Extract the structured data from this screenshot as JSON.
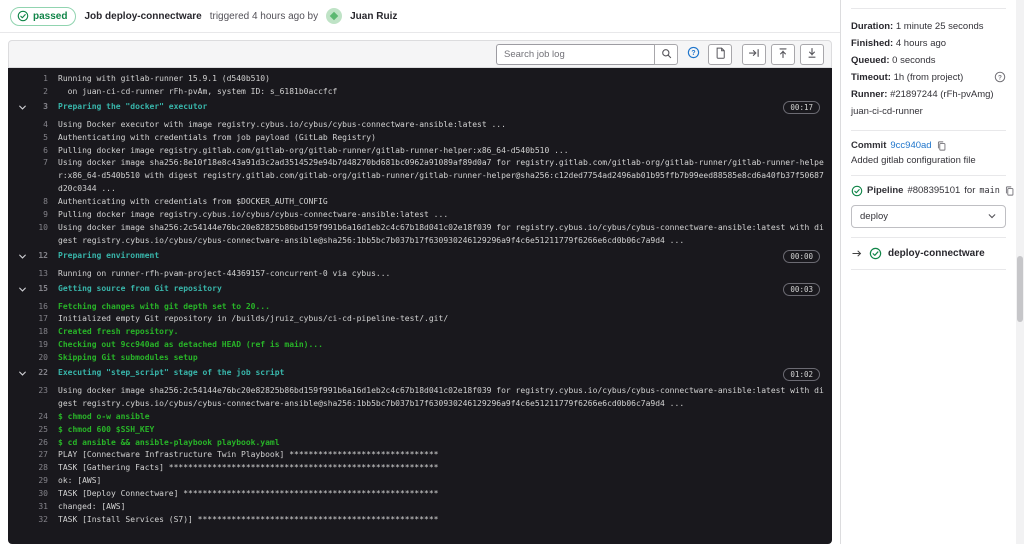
{
  "header": {
    "status_badge": "passed",
    "job_label": "Job deploy-connectware",
    "triggered_text": "triggered 4 hours ago by",
    "user": "Juan Ruiz"
  },
  "toolbar": {
    "search_placeholder": "Search job log"
  },
  "log": {
    "lines": [
      {
        "num": 1,
        "type": "plain",
        "text": "Running with gitlab-runner 15.9.1 (d540b510)"
      },
      {
        "num": 2,
        "type": "plain",
        "text": "  on juan-ci-cd-runner rFh-pvAm, system ID: s_6181b0accfcf"
      },
      {
        "num": 3,
        "type": "section",
        "duration": "00:17",
        "text": "Preparing the \"docker\" executor"
      },
      {
        "num": 4,
        "type": "plain",
        "text": "Using Docker executor with image registry.cybus.io/cybus/cybus-connectware-ansible:latest ..."
      },
      {
        "num": 5,
        "type": "plain",
        "text": "Authenticating with credentials from job payload (GitLab Registry)"
      },
      {
        "num": 6,
        "type": "plain",
        "text": "Pulling docker image registry.gitlab.com/gitlab-org/gitlab-runner/gitlab-runner-helper:x86_64-d540b510 ..."
      },
      {
        "num": 7,
        "type": "plain",
        "text": "Using docker image sha256:8e10f18e8c43a91d3c2ad3514529e94b7d48270bd681bc0962a91089af89d0a7 for registry.gitlab.com/gitlab-org/gitlab-runner/gitlab-runner-helper:x86_64-d540b510 with digest registry.gitlab.com/gitlab-org/gitlab-runner/gitlab-runner-helper@sha256:c12ded7754ad2496ab01b95ffb7b99eed88585e8cd6a40fb37f50687d20c0344 ..."
      },
      {
        "num": 8,
        "type": "plain",
        "text": "Authenticating with credentials from $DOCKER_AUTH_CONFIG"
      },
      {
        "num": 9,
        "type": "plain",
        "text": "Pulling docker image registry.cybus.io/cybus/cybus-connectware-ansible:latest ..."
      },
      {
        "num": 10,
        "type": "plain",
        "text": "Using docker image sha256:2c54144e76bc20e82825b86bd159f991b6a16d1eb2c4c67b18d041c02e18f039 for registry.cybus.io/cybus/cybus-connectware-ansible:latest with digest registry.cybus.io/cybus/cybus-connectware-ansible@sha256:1bb5bc7b037b17f630930246129296a9f4c6e51211779f6266e6cd0b06c7a9d4 ..."
      },
      {
        "num": 12,
        "type": "section",
        "duration": "00:00",
        "text": "Preparing environment"
      },
      {
        "num": 13,
        "type": "plain",
        "text": "Running on runner-rfh-pvam-project-44369157-concurrent-0 via cybus..."
      },
      {
        "num": 15,
        "type": "section",
        "duration": "00:03",
        "text": "Getting source from Git repository"
      },
      {
        "num": 16,
        "type": "green",
        "text": "Fetching changes with git depth set to 20..."
      },
      {
        "num": 17,
        "type": "plain",
        "text": "Initialized empty Git repository in /builds/jruiz_cybus/ci-cd-pipeline-test/.git/"
      },
      {
        "num": 18,
        "type": "green",
        "text": "Created fresh repository."
      },
      {
        "num": 19,
        "type": "green",
        "text": "Checking out 9cc940ad as detached HEAD (ref is main)..."
      },
      {
        "num": 20,
        "type": "green",
        "text": "Skipping Git submodules setup"
      },
      {
        "num": 22,
        "type": "section",
        "duration": "01:02",
        "text": "Executing \"step_script\" stage of the job script"
      },
      {
        "num": 23,
        "type": "plain",
        "text": "Using docker image sha256:2c54144e76bc20e82825b86bd159f991b6a16d1eb2c4c67b18d041c02e18f039 for registry.cybus.io/cybus/cybus-connectware-ansible:latest with digest registry.cybus.io/cybus/cybus-connectware-ansible@sha256:1bb5bc7b037b17f630930246129296a9f4c6e51211779f6266e6cd0b06c7a9d4 ..."
      },
      {
        "num": 24,
        "type": "green",
        "text": "$ chmod o-w ansible"
      },
      {
        "num": 25,
        "type": "green",
        "text": "$ chmod 600 $SSH_KEY"
      },
      {
        "num": 26,
        "type": "green",
        "text": "$ cd ansible && ansible-playbook playbook.yaml"
      },
      {
        "num": 27,
        "type": "plain",
        "text": "PLAY [Connectware Infrastructure Twin Playbook] *******************************"
      },
      {
        "num": 28,
        "type": "plain",
        "text": "TASK [Gathering Facts] ********************************************************"
      },
      {
        "num": 29,
        "type": "plain",
        "text": "ok: [AWS]"
      },
      {
        "num": 30,
        "type": "plain",
        "text": "TASK [Deploy Connectware] *****************************************************"
      },
      {
        "num": 31,
        "type": "plain",
        "text": "changed: [AWS]"
      },
      {
        "num": 32,
        "type": "plain",
        "text": "TASK [Install Services (S7)] **************************************************"
      }
    ]
  },
  "sidebar": {
    "details": [
      {
        "label": "Duration:",
        "value": "1 minute 25 seconds"
      },
      {
        "label": "Finished:",
        "value": "4 hours ago"
      },
      {
        "label": "Queued:",
        "value": "0 seconds"
      },
      {
        "label": "Timeout:",
        "value": "1h (from project)",
        "help": true
      },
      {
        "label": "Runner:",
        "value": "#21897244 (rFh-pvAmg) juan-ci-cd-runner"
      }
    ],
    "commit": {
      "label": "Commit",
      "sha": "9cc940ad",
      "message": "Added gitlab configuration file"
    },
    "pipeline": {
      "label": "Pipeline",
      "id": "#808395101",
      "for_text": "for",
      "ref": "main"
    },
    "stage_select": "deploy",
    "job_item": "deploy-connectware"
  },
  "colors": {
    "status_green": "#108548",
    "link_blue": "#1f75cb",
    "help_blue": "#1f75cb",
    "log_bg": "#19181d",
    "log_text": "#d2d2d2",
    "log_section_teal": "#38b5aa",
    "log_green": "#28b428",
    "line_number_gray": "#84838a",
    "toolbar_bg": "#f5f5f6",
    "border_gray": "#dcdcde"
  }
}
